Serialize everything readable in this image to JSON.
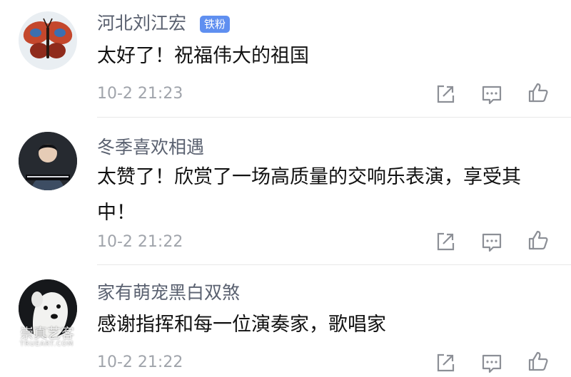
{
  "comments": [
    {
      "username": "河北刘江宏",
      "badge": "铁粉",
      "text": "太好了！祝福伟大的祖国",
      "time": "10-2 21:23",
      "avatar": "butterfly-avatar"
    },
    {
      "username": "冬季喜欢相遇",
      "text": "太赞了！欣赏了一场高质量的交响乐表演，享受其中！",
      "time": "10-2 21:22",
      "avatar": "pianist-avatar"
    },
    {
      "username": "家有萌宠黑白双煞",
      "text": "感谢指挥和每一位演奏家，歌唱家",
      "time": "10-2 21:22",
      "avatar": "dog-avatar"
    }
  ],
  "actions": {
    "icons": [
      "share-icon",
      "comment-icon",
      "like-icon"
    ]
  },
  "watermark": {
    "logo": "崇真艺客",
    "url": "TRUEART.COM"
  },
  "colors": {
    "username": "#5a6170",
    "badge": "#5f8ff0",
    "text": "#111111",
    "time": "#a0a4ab"
  }
}
